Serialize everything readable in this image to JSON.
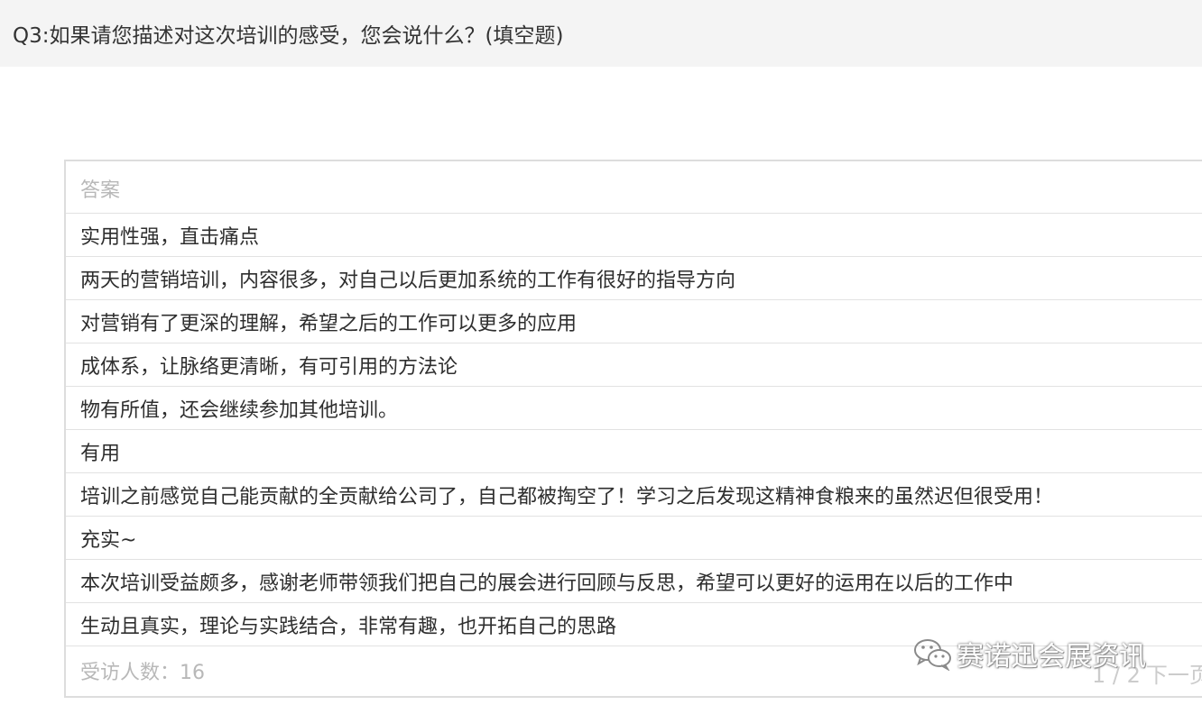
{
  "question": {
    "title": "Q3:如果请您描述对这次培训的感受，您会说什么？(填空题)"
  },
  "table": {
    "header": "答案",
    "rows": [
      "实用性强，直击痛点",
      "两天的营销培训，内容很多，对自己以后更加系统的工作有很好的指导方向",
      "对营销有了更深的理解，希望之后的工作可以更多的应用",
      "成体系，让脉络更清晰，有可引用的方法论",
      "物有所值，还会继续参加其他培训。",
      "有用",
      "培训之前感觉自己能贡献的全贡献给公司了，自己都被掏空了！学习之后发现这精神食粮来的虽然迟但很受用！",
      "充实~",
      "本次培训受益颇多，感谢老师带领我们把自己的展会进行回顾与反思，希望可以更好的运用在以后的工作中",
      "生动且真实，理论与实践结合，非常有趣，也开拓自己的思路"
    ],
    "footer": {
      "respondents": "受访人数：16",
      "page_indicator": "1 / 2",
      "next_label": "下一页"
    }
  },
  "watermark": {
    "icon": "wechat-icon",
    "text": "赛诺迅会展资讯"
  },
  "colors": {
    "question_bg": "#f4f4f4",
    "border": "#dddddd",
    "muted_text": "#b8b8b8",
    "body_text": "#2e2e2e"
  }
}
